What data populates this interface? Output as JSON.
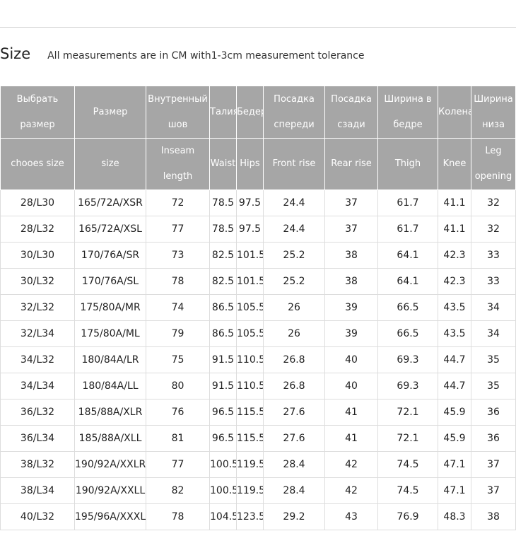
{
  "title": "Size",
  "subtitle": "All measurements are in CM with1-3cm measurement tolerance",
  "headers_ru": [
    "Выбрать размер",
    "Размер",
    "Внутренный шов",
    "Талия",
    "Бедер",
    "Посадка спереди",
    "Посадка сзади",
    "Ширина в бедре",
    "Колена",
    "Ширина низа"
  ],
  "headers_en": [
    "chooes size",
    "size",
    "Inseam length",
    "Waist",
    "Hips",
    "Front rise",
    "Rear rise",
    "Thigh",
    "Knee",
    "Leg opening"
  ],
  "rows": [
    [
      "28/L30",
      "165/72A/XSR",
      "72",
      "78.5",
      "97.5",
      "24.4",
      "37",
      "61.7",
      "41.1",
      "32"
    ],
    [
      "28/L32",
      "165/72A/XSL",
      "77",
      "78.5",
      "97.5",
      "24.4",
      "37",
      "61.7",
      "41.1",
      "32"
    ],
    [
      "30/L30",
      "170/76A/SR",
      "73",
      "82.5",
      "101.5",
      "25.2",
      "38",
      "64.1",
      "42.3",
      "33"
    ],
    [
      "30/L32",
      "170/76A/SL",
      "78",
      "82.5",
      "101.5",
      "25.2",
      "38",
      "64.1",
      "42.3",
      "33"
    ],
    [
      "32/L32",
      "175/80A/MR",
      "74",
      "86.5",
      "105.5",
      "26",
      "39",
      "66.5",
      "43.5",
      "34"
    ],
    [
      "32/L34",
      "175/80A/ML",
      "79",
      "86.5",
      "105.5",
      "26",
      "39",
      "66.5",
      "43.5",
      "34"
    ],
    [
      "34/L32",
      "180/84A/LR",
      "75",
      "91.5",
      "110.5",
      "26.8",
      "40",
      "69.3",
      "44.7",
      "35"
    ],
    [
      "34/L34",
      "180/84A/LL",
      "80",
      "91.5",
      "110.5",
      "26.8",
      "40",
      "69.3",
      "44.7",
      "35"
    ],
    [
      "36/L32",
      "185/88A/XLR",
      "76",
      "96.5",
      "115.5",
      "27.6",
      "41",
      "72.1",
      "45.9",
      "36"
    ],
    [
      "36/L34",
      "185/88A/XLL",
      "81",
      "96.5",
      "115.5",
      "27.6",
      "41",
      "72.1",
      "45.9",
      "36"
    ],
    [
      "38/L32",
      "190/92A/XXLR",
      "77",
      "100.5",
      "119.5",
      "28.4",
      "42",
      "74.5",
      "47.1",
      "37"
    ],
    [
      "38/L34",
      "190/92A/XXLL",
      "82",
      "100.5",
      "119.5",
      "28.4",
      "42",
      "74.5",
      "47.1",
      "37"
    ],
    [
      "40/L32",
      "195/96A/XXXLR",
      "78",
      "104.5",
      "123.5",
      "29.2",
      "43",
      "76.9",
      "48.3",
      "38"
    ]
  ],
  "colors": {
    "header_bg": "#a6a6a6",
    "header_text": "#ffffff",
    "grid_line": "#dddddd"
  }
}
